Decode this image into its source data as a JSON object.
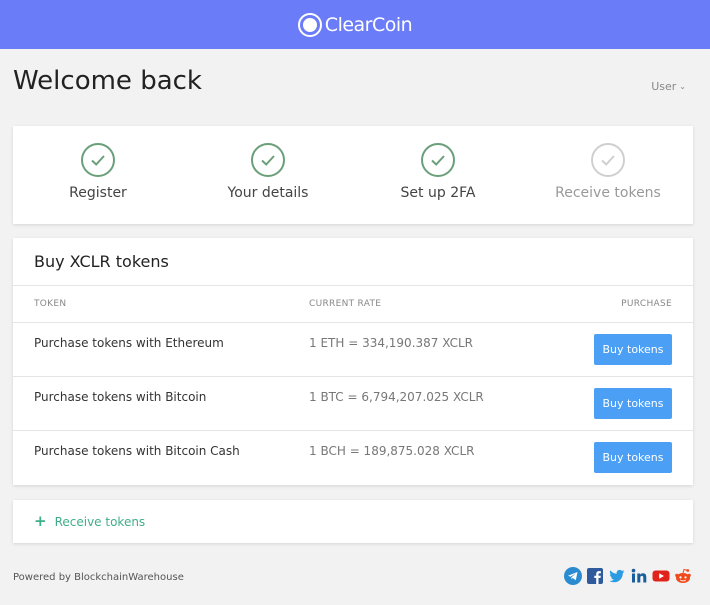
{
  "header": {
    "brand": "ClearCoin",
    "brand_color": "#6b7cf8"
  },
  "page": {
    "title": "Welcome back",
    "user_menu": "User"
  },
  "steps": [
    {
      "label": "Register",
      "status": "complete"
    },
    {
      "label": "Your details",
      "status": "complete"
    },
    {
      "label": "Set up 2FA",
      "status": "complete"
    },
    {
      "label": "Receive tokens",
      "status": "pending"
    }
  ],
  "buy": {
    "title": "Buy XCLR tokens",
    "columns": {
      "token": "TOKEN",
      "rate": "CURRENT RATE",
      "purchase": "PURCHASE"
    },
    "rows": [
      {
        "token": "Purchase tokens with Ethereum",
        "rate": "1 ETH = 334,190.387 XCLR",
        "button": "Buy tokens"
      },
      {
        "token": "Purchase tokens with Bitcoin",
        "rate": "1 BTC = 6,794,207.025 XCLR",
        "button": "Buy tokens"
      },
      {
        "token": "Purchase tokens with Bitcoin Cash",
        "rate": "1 BCH = 189,875.028 XCLR",
        "button": "Buy tokens"
      }
    ],
    "button_color": "#4b9ff5"
  },
  "receive": {
    "label": "Receive tokens",
    "icon": "plus-icon",
    "color": "#3fae8a"
  },
  "footer": {
    "powered_by": "Powered by BlockchainWarehouse",
    "socials": [
      "telegram-icon",
      "facebook-icon",
      "twitter-icon",
      "linkedin-icon",
      "youtube-icon",
      "reddit-icon"
    ]
  }
}
